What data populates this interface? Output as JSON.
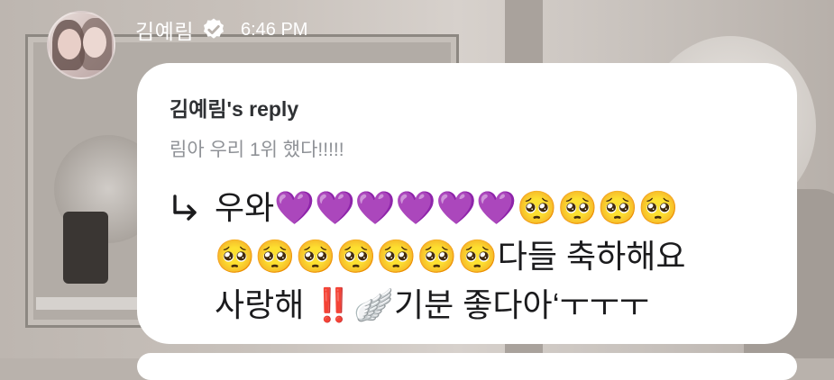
{
  "post": {
    "username": "김예림",
    "timestamp": "6:46 PM",
    "verified_icon": "verified-badge-icon",
    "avatar_icon": "profile-photo"
  },
  "reply": {
    "title": "김예림's reply",
    "quoted_text": "림아 우리 1위 했다!!!!!",
    "arrow_icon": "reply-arrow-icon",
    "message_lines": [
      "우와💜💜💜💜💜💜🥺🥺🥺🥺",
      "🥺🥺🥺🥺🥺🥺🥺다들 축하해요",
      "사랑해 ‼️🪽기분 좋다아‘ㅜㅜㅜ"
    ]
  },
  "colors": {
    "card_bg": "#ffffff",
    "title_text": "#2f3134",
    "quoted_text": "#8f9297",
    "message_text": "#1b1b1d",
    "header_text": "#ffffff"
  }
}
